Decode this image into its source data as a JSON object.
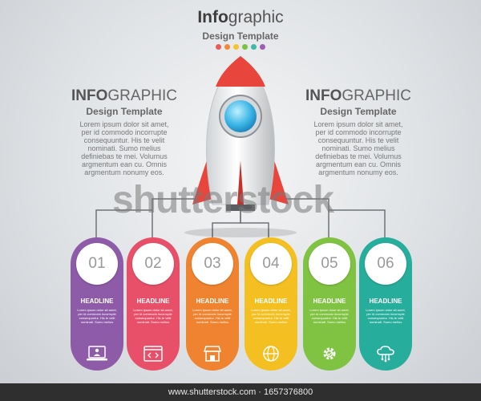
{
  "header": {
    "title_bold": "Info",
    "title_rest": "graphic",
    "subtitle": "Design Template"
  },
  "dot_colors": [
    "#ea5b5b",
    "#f08a34",
    "#f5c32b",
    "#7cc242",
    "#3cb9a8",
    "#9b5fb4"
  ],
  "left_block": {
    "title_bold": "INFO",
    "title_rest": "GRAPHIC",
    "subtitle": "Design Template",
    "body": "Lorem ipsum dolor sit amet,\nper id commodo incorrupte\nconsequuntur. His te velit\nnominati. Sumo melius\ndefiniebas te mei. Volumus\nargmentum ean cu. Omnis\nargmentum nonumy eos."
  },
  "right_block": {
    "title_bold": "INFO",
    "title_rest": "GRAPHIC",
    "subtitle": "Design Template",
    "body": "Lorem ipsum dolor sit amet,\nper id commodo incorrupte\nconsequuntur. His te velit\nnominati. Sumo melius\ndefiniebas te mei. Volumus\nargmentum ean cu. Omnis\nargmentum nonumy eos."
  },
  "watermark": "shutterstock",
  "cards": [
    {
      "num": "01",
      "headline": "HEADLINE",
      "body": "Lorem ipsum dolor sit amet,\nper id commodo incorrupte\nconsequuntur. His te velit\nnominati. Sumo melius",
      "color": "#8e5ba8",
      "icon": "laptop-user-icon"
    },
    {
      "num": "02",
      "headline": "HEADLINE",
      "body": "Lorem ipsum dolor sit amet,\nper id commodo incorrupte\nconsequuntur. His te velit\nnominati. Sumo melius",
      "color": "#e8506a",
      "icon": "code-window-icon"
    },
    {
      "num": "03",
      "headline": "HEADLINE",
      "body": "Lorem ipsum dolor sit amet,\nper id commodo incorrupte\nconsequuntur. His te velit\nnominati. Sumo melius",
      "color": "#f0832f",
      "icon": "shop-icon"
    },
    {
      "num": "04",
      "headline": "HEADLINE",
      "body": "Lorem ipsum dolor sit amet,\nper id commodo incorrupte\nconsequuntur. His te velit\nnominati. Sumo melius",
      "color": "#f4c021",
      "icon": "globe-icon"
    },
    {
      "num": "05",
      "headline": "HEADLINE",
      "body": "Lorem ipsum dolor sit amet,\nper id commodo incorrupte\nconsequuntur. His te velit\nnominati. Sumo melius",
      "color": "#80c241",
      "icon": "gear-icon"
    },
    {
      "num": "06",
      "headline": "HEADLINE",
      "body": "Lorem ipsum dolor sit amet,\nper id commodo incorrupte\nconsequuntur. His te velit\nnominati. Sumo melius",
      "color": "#27ad9c",
      "icon": "cloud-network-icon"
    }
  ],
  "footer": {
    "text": "www.shutterstock.com · 1657376800"
  }
}
